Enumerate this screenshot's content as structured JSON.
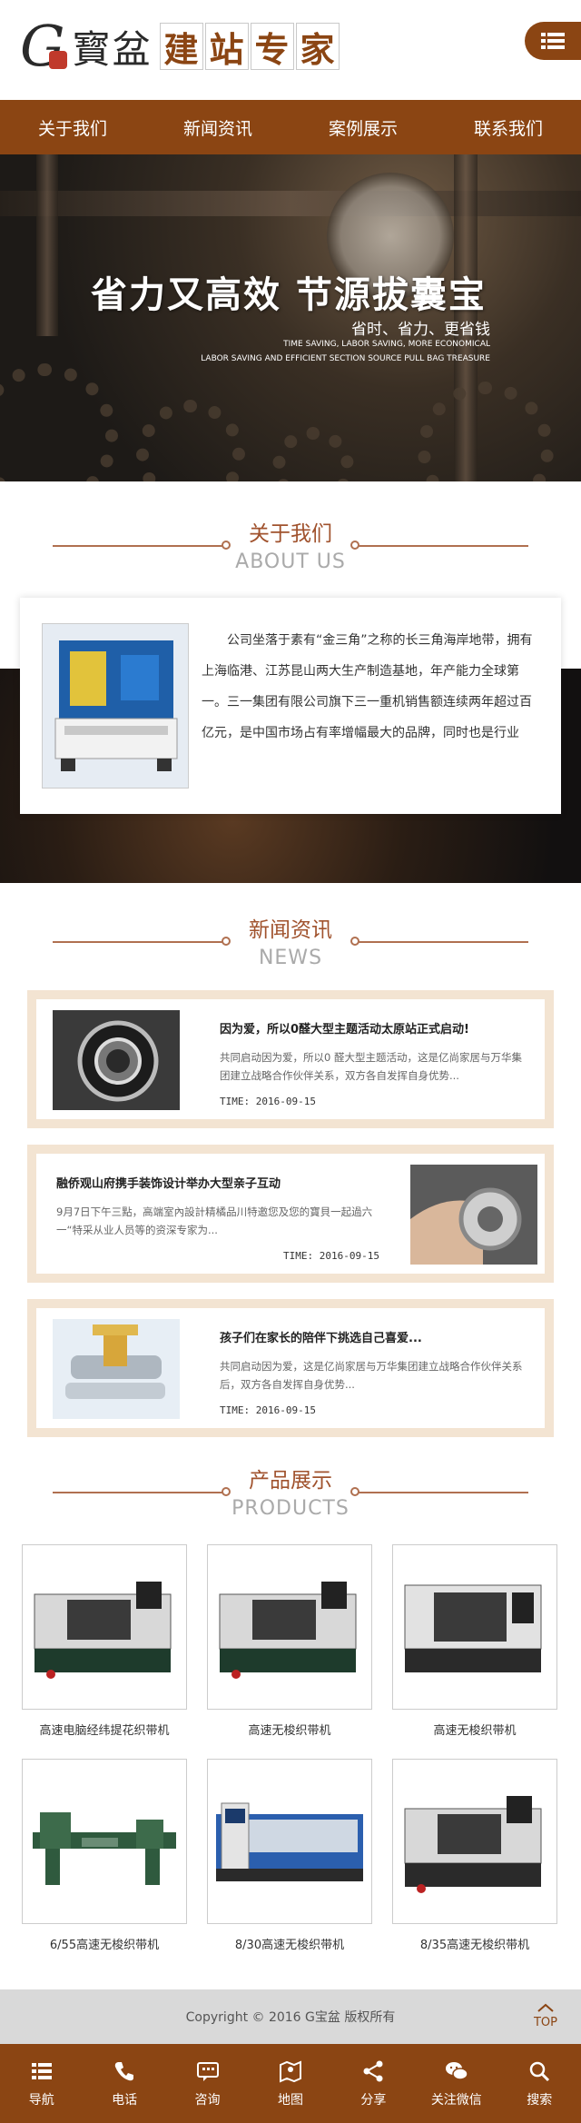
{
  "header": {
    "logo_letter": "G",
    "logo_name": "寳盆",
    "slogan_chars": [
      "建",
      "站",
      "专",
      "家"
    ]
  },
  "nav": [
    "关于我们",
    "新闻资讯",
    "案例展示",
    "联系我们"
  ],
  "banner": {
    "title": "省力又高效 节源拔囊宝",
    "subtitle": "省时、省力、更省钱",
    "en_line1": "TIME SAVING, LABOR SAVING, MORE ECONOMICAL",
    "en_line2": "LABOR SAVING AND EFFICIENT SECTION SOURCE PULL BAG TREASURE"
  },
  "about": {
    "title_cn": "关于我们",
    "title_en": "ABOUT US",
    "text": "公司坐落于素有“金三角”之称的长三角海岸地带，拥有上海临港、江苏昆山两大生产制造基地，年产能力全球第一。三一集团有限公司旗下三一重机销售额连续两年超过百亿元，是中国市场占有率增幅最大的品牌，同时也是行业"
  },
  "news": {
    "title_cn": "新闻资讯",
    "title_en": "NEWS",
    "items": [
      {
        "title": "因为爱，所以0醛大型主题活动太原站正式启动!",
        "desc": "共同启动因为爱，所以0 醛大型主题活动，这是亿尚家居与万华集团建立战略合作伙伴关系，双方各自发挥自身优势...",
        "time": "TIME: 2016-09-15"
      },
      {
        "title": "融侨观山府携手装饰设计举办大型亲子互动",
        "desc": "9月7日下午三點，高端室內設計精橘品川特邀您及您的寶貝一起過六一“特采从业人员等的资深专家为...",
        "time": "TIME: 2016-09-15"
      },
      {
        "title": "孩子们在家长的陪伴下挑选自己喜爱...",
        "desc": "共同启动因为爱，这是亿尚家居与万华集团建立战略合作伙伴关系后，双方各自发挥自身优势...",
        "time": "TIME: 2016-09-15"
      }
    ]
  },
  "products": {
    "title_cn": "产品展示",
    "title_en": "PRODUCTS",
    "items": [
      {
        "name": "高速电脑经纬提花织带机"
      },
      {
        "name": "高速无梭织带机"
      },
      {
        "name": "高速无梭织带机"
      },
      {
        "name": "6/55高速无梭织带机"
      },
      {
        "name": "8/30高速无梭织带机"
      },
      {
        "name": "8/35高速无梭织带机"
      }
    ]
  },
  "footer": {
    "copyright": "Copyright © 2016 G宝盆 版权所有",
    "top_label": "TOP"
  },
  "bottom_bar": [
    {
      "label": "导航",
      "icon": "menu-icon"
    },
    {
      "label": "电话",
      "icon": "phone-icon"
    },
    {
      "label": "咨询",
      "icon": "chat-icon"
    },
    {
      "label": "地图",
      "icon": "map-icon"
    },
    {
      "label": "分享",
      "icon": "share-icon"
    },
    {
      "label": "关注微信",
      "icon": "wechat-icon"
    },
    {
      "label": "搜索",
      "icon": "search-icon"
    }
  ],
  "colors": {
    "brand": "#8b4513",
    "accent": "#a0522d",
    "news_frame": "#f3e4d2"
  }
}
